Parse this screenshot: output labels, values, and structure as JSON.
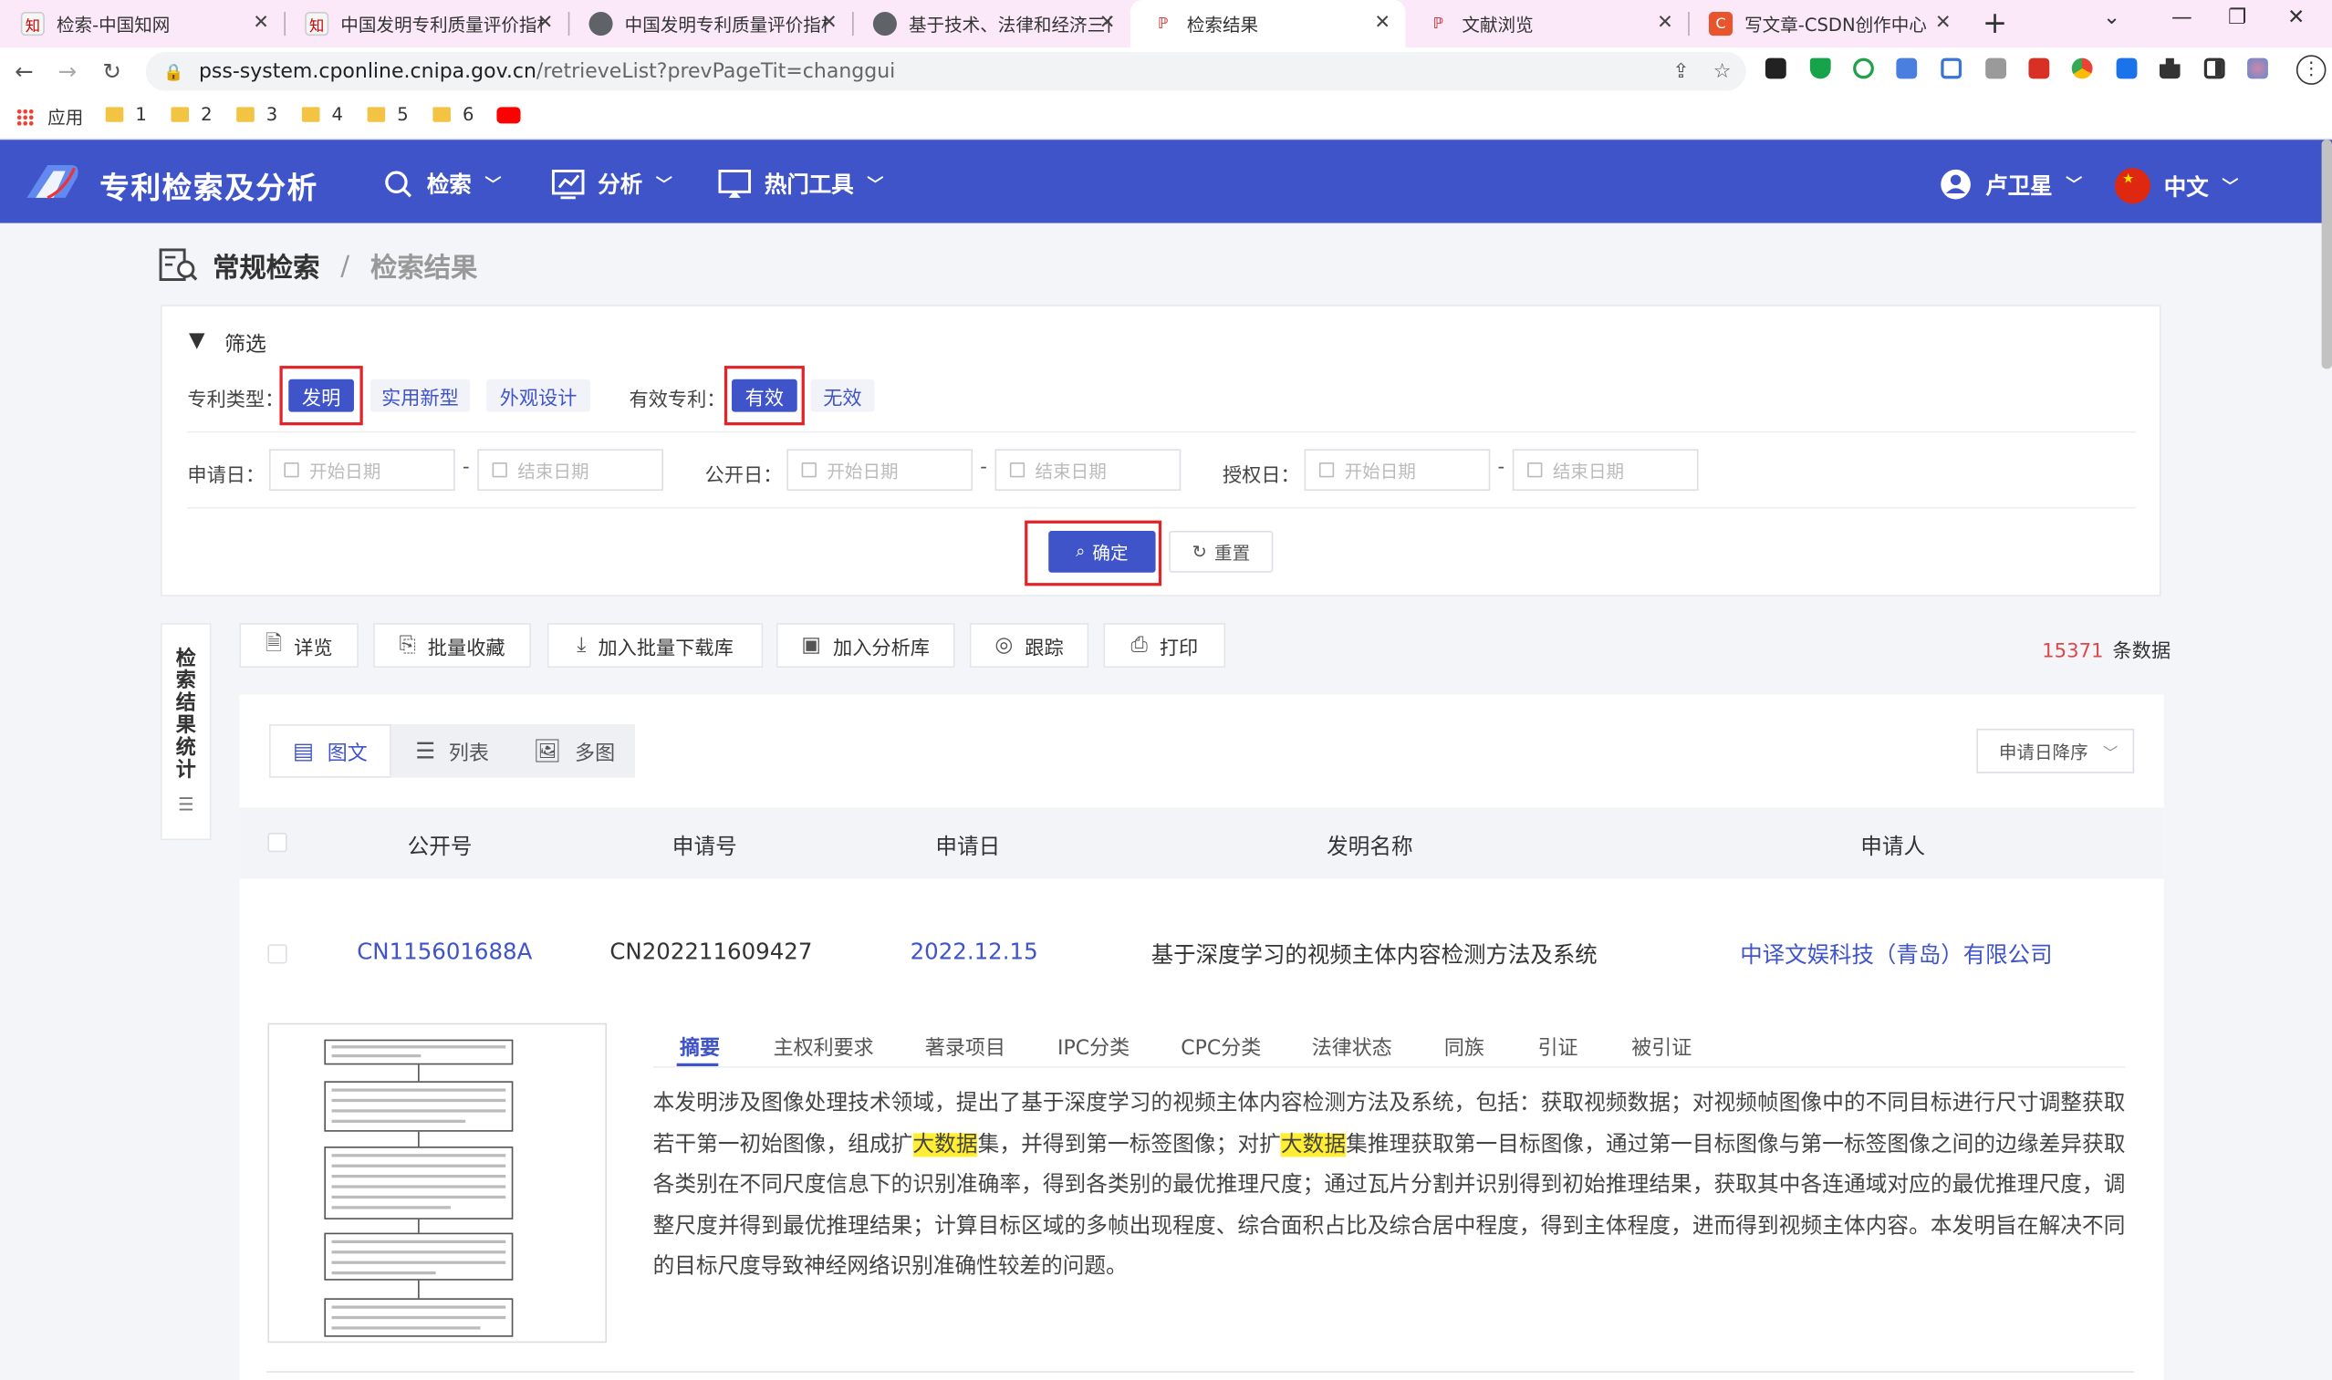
{
  "browser": {
    "tabs": [
      {
        "title": "检索-中国知网",
        "fav_color": "#f6f6f6",
        "fav_text": "知"
      },
      {
        "title": "中国发明专利质量评价指标",
        "fav_color": "#f6f6f6",
        "fav_text": "知"
      },
      {
        "title": "中国发明专利质量评价指标",
        "fav_color": "#5f6368",
        "fav_text": ""
      },
      {
        "title": "基于技术、法律和经济三位",
        "fav_color": "#5f6368",
        "fav_text": ""
      },
      {
        "title": "检索结果",
        "fav_color": "#ffffff",
        "fav_text": "P"
      },
      {
        "title": "文献浏览",
        "fav_color": "#ffffff",
        "fav_text": "P"
      },
      {
        "title": "写文章-CSDN创作中心",
        "fav_color": "#e8542b",
        "fav_text": "C"
      }
    ],
    "new_tab": "+",
    "url_host": "pss-system.cponline.cnipa.gov.cn",
    "url_path": "/retrieveList?prevPageTit=changgui",
    "bookmarks": [
      {
        "label": "应用",
        "icon": "apps-grid-icon"
      },
      {
        "label": "1",
        "icon": "folder-icon"
      },
      {
        "label": "2",
        "icon": "folder-icon"
      },
      {
        "label": "3",
        "icon": "folder-icon"
      },
      {
        "label": "4",
        "icon": "folder-icon"
      },
      {
        "label": "5",
        "icon": "folder-icon"
      },
      {
        "label": "6",
        "icon": "folder-icon"
      }
    ]
  },
  "app": {
    "brand": "专利检索及分析",
    "nav": [
      {
        "label": "检索",
        "icon": "search-icon"
      },
      {
        "label": "分析",
        "icon": "chart-icon"
      },
      {
        "label": "热门工具",
        "icon": "monitor-icon"
      }
    ],
    "user": "卢卫星",
    "lang": "中文",
    "accent": "#4054c9"
  },
  "breadcrumb": {
    "first": "常规检索",
    "sep": "/",
    "current": "检索结果"
  },
  "filter": {
    "title": "筛选",
    "type_label": "专利类型：",
    "types": [
      "发明",
      "实用新型",
      "外观设计"
    ],
    "valid_label": "有效专利：",
    "valid_options": [
      "有效",
      "无效"
    ],
    "apply_date_label": "申请日：",
    "pub_date_label": "公开日：",
    "grant_date_label": "授权日：",
    "start_placeholder": "开始日期",
    "end_placeholder": "结束日期",
    "dash": "-",
    "confirm": "确定",
    "reset": "重置"
  },
  "side_stats": {
    "label": [
      "检",
      "索",
      "结",
      "果",
      "统",
      "计"
    ]
  },
  "toolbar": {
    "items": [
      {
        "label": "详览",
        "icon": "document-icon"
      },
      {
        "label": "批量收藏",
        "icon": "bookmark-add-icon"
      },
      {
        "label": "加入批量下载库",
        "icon": "download-icon"
      },
      {
        "label": "加入分析库",
        "icon": "analysis-icon"
      },
      {
        "label": "跟踪",
        "icon": "track-icon"
      },
      {
        "label": "打印",
        "icon": "printer-icon"
      }
    ],
    "count": "15371",
    "count_suffix": "条数据"
  },
  "results": {
    "views": [
      "图文",
      "列表",
      "多图"
    ],
    "sort": "申请日降序",
    "columns": [
      "公开号",
      "申请号",
      "申请日",
      "发明名称",
      "申请人"
    ],
    "row": {
      "pub_no": "CN115601688A",
      "app_no": "CN202211609427",
      "app_date": "2022.12.15",
      "title": "基于深度学习的视频主体内容检测方法及系统",
      "applicant": "中译文娱科技（青岛）有限公司"
    },
    "subtabs": [
      "摘要",
      "主权利要求",
      "著录项目",
      "IPC分类",
      "CPC分类",
      "法律状态",
      "同族",
      "引证",
      "被引证"
    ],
    "abstract_parts": [
      "本发明涉及图像处理技术领域，提出了基于深度学习的视频主体内容检测方法及系统，包括：获取视频数据；对视频帧图像中的不同目标进行尺寸调整获取若干第一初始图像，组成扩",
      "大数据",
      "集，并得到第一标签图像；对扩",
      "大数据",
      "集推理获取第一目标图像，通过第一目标图像与第一标签图像之间的边缘差异获取各类别在不同尺度信息下的识别准确率，得到各类别的最优推理尺度；通过瓦片分割并识别得到初始推理结果，获取其中各连通域对应的最优推理尺度，调整尺度并得到最优推理结果；计算目标区域的多帧出现程度、综合面积占比及综合居中程度，得到主体程度，进而得到视频主体内容。本发明旨在解决不同的目标尺度导致神经网络识别准确性较差的问题。"
    ]
  }
}
